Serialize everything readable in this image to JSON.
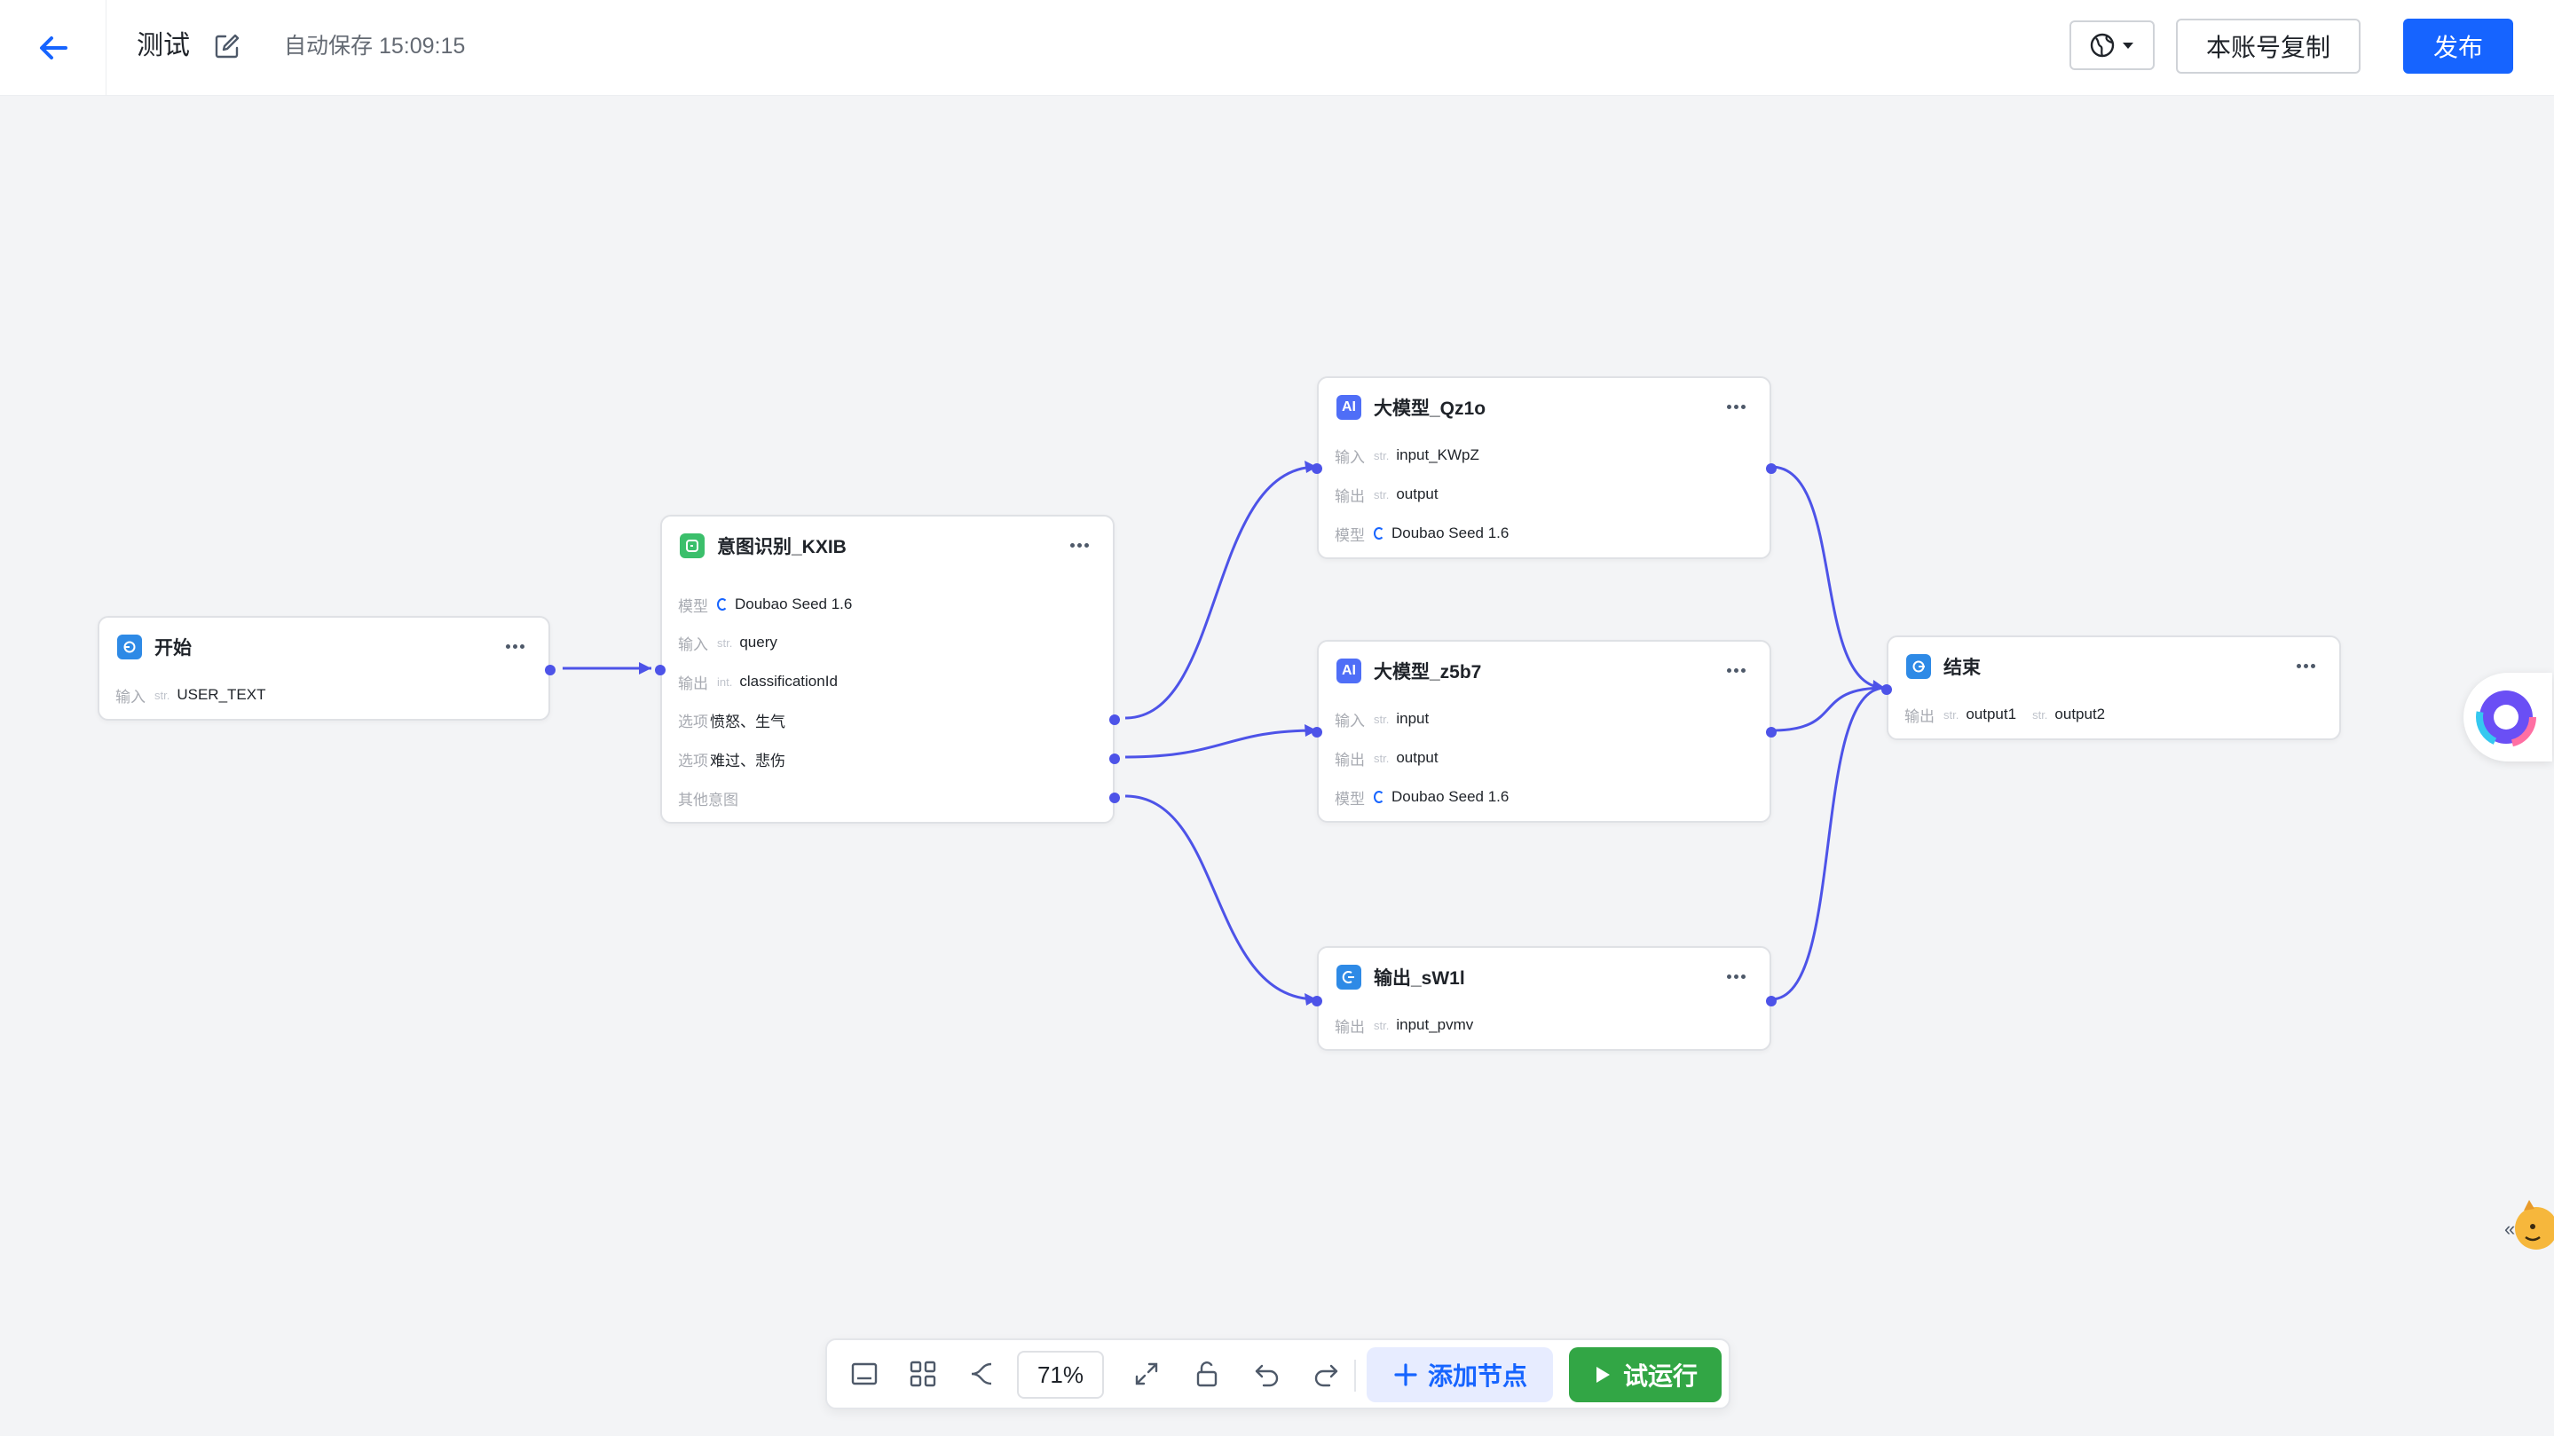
{
  "header": {
    "title": "测试",
    "autosave": "自动保存 15:09:15",
    "copy_label": "本账号复制",
    "publish_label": "发布",
    "back_icon": "arrow-left-icon",
    "edit_icon": "edit-icon",
    "lang_icon": "globe-icon"
  },
  "colors": {
    "accent": "#1664ff",
    "edge": "#4d53e8",
    "run": "#32a645"
  },
  "nodes": {
    "start": {
      "title": "开始",
      "rows": [
        {
          "label": "输入",
          "type": "str.",
          "value": "USER_TEXT"
        }
      ]
    },
    "intent": {
      "title": "意图识别_KXIB",
      "model_label": "模型",
      "model": "Doubao Seed 1.6",
      "input_label": "输入",
      "input_type": "str.",
      "input": "query",
      "output_label": "输出",
      "output_type": "int.",
      "output": "classificationId",
      "option_label": "选项",
      "option1": "愤怒、生气",
      "option2": "难过、悲伤",
      "other": "其他意图"
    },
    "llm1": {
      "title": "大模型_Qz1o",
      "input_label": "输入",
      "input_type": "str.",
      "input": "input_KWpZ",
      "output_label": "输出",
      "output_type": "str.",
      "output": "output",
      "model_label": "模型",
      "model": "Doubao Seed 1.6"
    },
    "llm2": {
      "title": "大模型_z5b7",
      "input_label": "输入",
      "input_type": "str.",
      "input": "input",
      "output_label": "输出",
      "output_type": "str.",
      "output": "output",
      "model_label": "模型",
      "model": "Doubao Seed 1.6"
    },
    "output": {
      "title": "输出_sW1l",
      "output_label": "输出",
      "output_type": "str.",
      "output": "input_pvmv"
    },
    "end": {
      "title": "结束",
      "output_label": "输出",
      "output_type": "str.",
      "output1": "output1",
      "output2": "output2"
    }
  },
  "toolbar": {
    "zoom": "71%",
    "add_node": "添加节点",
    "run": "试运行"
  }
}
